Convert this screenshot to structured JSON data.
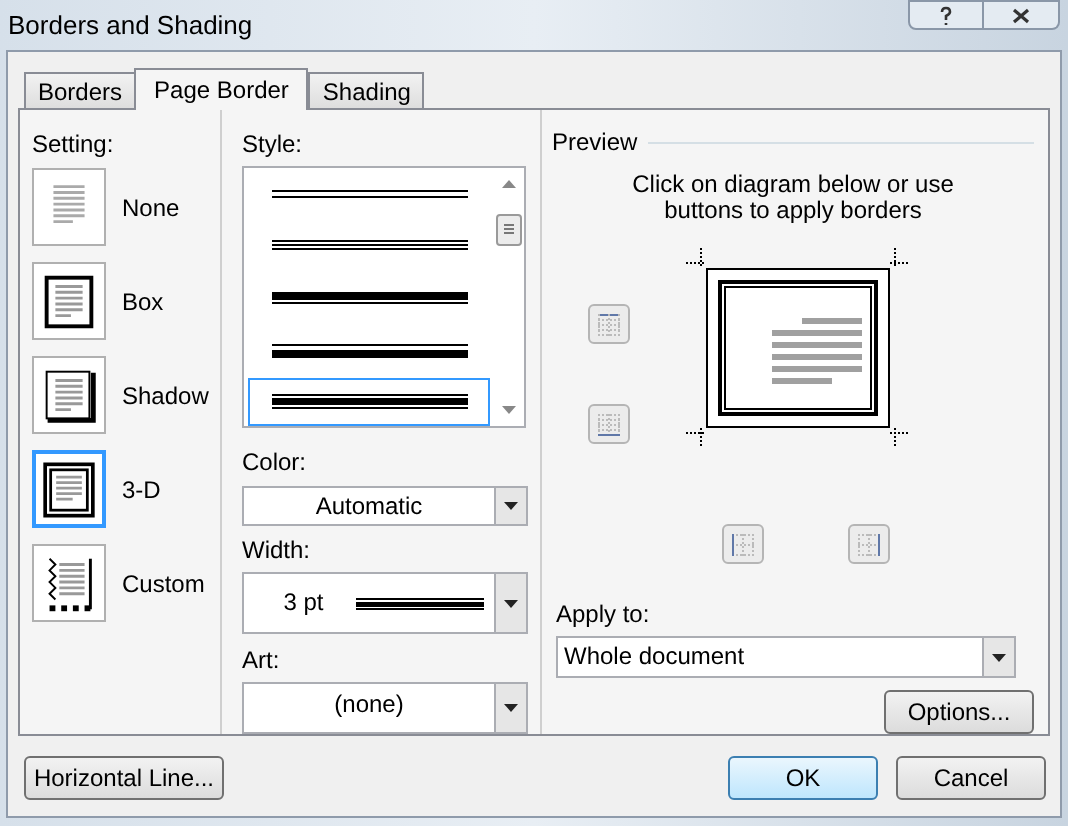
{
  "window": {
    "title": "Borders and Shading"
  },
  "tabs": [
    {
      "label": "Borders",
      "selected": false
    },
    {
      "label": "Page Border",
      "selected": true
    },
    {
      "label": "Shading",
      "selected": false
    }
  ],
  "setting": {
    "label": "Setting:",
    "options": [
      {
        "label": "None",
        "kind": "none",
        "selected": false
      },
      {
        "label": "Box",
        "kind": "box",
        "selected": false
      },
      {
        "label": "Shadow",
        "kind": "shadow",
        "selected": false
      },
      {
        "label": "3-D",
        "kind": "dimensional",
        "selected": true
      },
      {
        "label": "Custom",
        "kind": "custom",
        "selected": false
      }
    ]
  },
  "style": {
    "label": "Style:",
    "items": [
      {
        "kind": "double",
        "selected": false
      },
      {
        "kind": "triple",
        "selected": false
      },
      {
        "kind": "thick-thin",
        "selected": false
      },
      {
        "kind": "thin-thick",
        "selected": false
      },
      {
        "kind": "thin-thick-thin",
        "selected": true
      }
    ]
  },
  "color": {
    "label": "Color:",
    "value": "Automatic"
  },
  "width": {
    "label": "Width:",
    "value": "3 pt"
  },
  "art": {
    "label": "Art:",
    "value": "(none)"
  },
  "preview": {
    "label": "Preview",
    "hint": "Click on diagram below or use buttons to apply borders"
  },
  "apply_to": {
    "label": "Apply to:",
    "value": "Whole document"
  },
  "options_button": "Options...",
  "footer": {
    "horizontal_line": "Horizontal Line...",
    "ok": "OK",
    "cancel": "Cancel"
  }
}
